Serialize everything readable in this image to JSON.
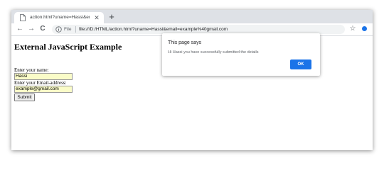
{
  "browser": {
    "tab": {
      "title": "action.html?uname=Hassi&ema",
      "close_glyph": "✕",
      "icon": "page-icon"
    },
    "new_tab_glyph": "+",
    "nav": {
      "back_glyph": "←",
      "forward_glyph": "→",
      "reload_glyph": "C"
    },
    "omnibox": {
      "scheme_label": "File",
      "url": "file:///D:/HTML/action.html?uname=Hassi&email=example%40gmail.com"
    },
    "star_glyph": "☆",
    "colors": {
      "tabstrip": "#dee1e6",
      "accent": "#1a73e8"
    }
  },
  "page": {
    "title": "External JavaScript Example",
    "name_label": "Enter your name:",
    "name_value": "Hassi",
    "email_label": "Enter your Email-address:",
    "email_value": "example@gmail.com",
    "submit_label": "Submit",
    "field_bg": "#fafcc8"
  },
  "dialog": {
    "title": "This page says",
    "message": "Hi Hassi you have successfully submitted the details",
    "ok_label": "OK"
  }
}
